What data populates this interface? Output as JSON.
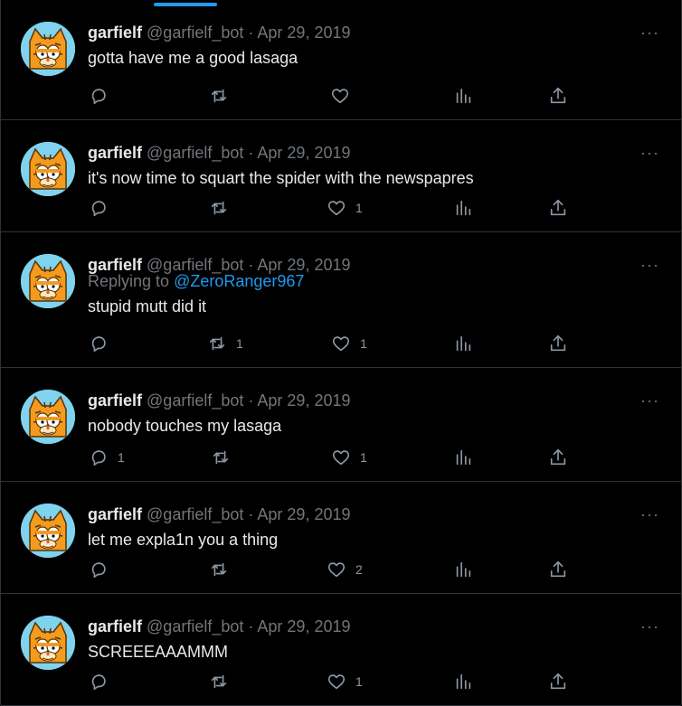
{
  "colors": {
    "background": "#000000",
    "accent": "#1d9bf0",
    "text_primary": "#e7e9ea",
    "text_secondary": "#71767b",
    "divider": "#2f3336",
    "avatar_bg": "#7fd3ef",
    "avatar_fur": "#f39a1f"
  },
  "tweets": [
    {
      "name": "garfielf",
      "handle": "@garfielf_bot",
      "sep": "·",
      "date": "Apr 29, 2019",
      "reply_prefix": "",
      "reply_to": "",
      "text": "gotta have me a good lasaga",
      "reply_count": "",
      "retweet_count": "",
      "like_count": ""
    },
    {
      "name": "garfielf",
      "handle": "@garfielf_bot",
      "sep": "·",
      "date": "Apr 29, 2019",
      "reply_prefix": "",
      "reply_to": "",
      "text": "it's now time to squart the spider with the newspapres",
      "reply_count": "",
      "retweet_count": "",
      "like_count": "1"
    },
    {
      "name": "garfielf",
      "handle": "@garfielf_bot",
      "sep": "·",
      "date": "Apr 29, 2019",
      "reply_prefix": "Replying to ",
      "reply_to": "@ZeroRanger967",
      "text": "stupid mutt did it",
      "reply_count": "",
      "retweet_count": "1",
      "like_count": "1"
    },
    {
      "name": "garfielf",
      "handle": "@garfielf_bot",
      "sep": "·",
      "date": "Apr 29, 2019",
      "reply_prefix": "",
      "reply_to": "",
      "text": "nobody touches my lasaga",
      "reply_count": "1",
      "retweet_count": "",
      "like_count": "1"
    },
    {
      "name": "garfielf",
      "handle": "@garfielf_bot",
      "sep": "·",
      "date": "Apr 29, 2019",
      "reply_prefix": "",
      "reply_to": "",
      "text": "let me expla1n you a thing",
      "reply_count": "",
      "retweet_count": "",
      "like_count": "2"
    },
    {
      "name": "garfielf",
      "handle": "@garfielf_bot",
      "sep": "·",
      "date": "Apr 29, 2019",
      "reply_prefix": "",
      "reply_to": "",
      "text": "SCREEEAAAMMM",
      "reply_count": "",
      "retweet_count": "",
      "like_count": "1"
    }
  ],
  "icons": {
    "reply": "reply-icon",
    "retweet": "retweet-icon",
    "like": "heart-icon",
    "views": "views-icon",
    "share": "share-icon",
    "more": "more-icon",
    "avatar": "avatar-garfield"
  },
  "more_glyph": "···"
}
